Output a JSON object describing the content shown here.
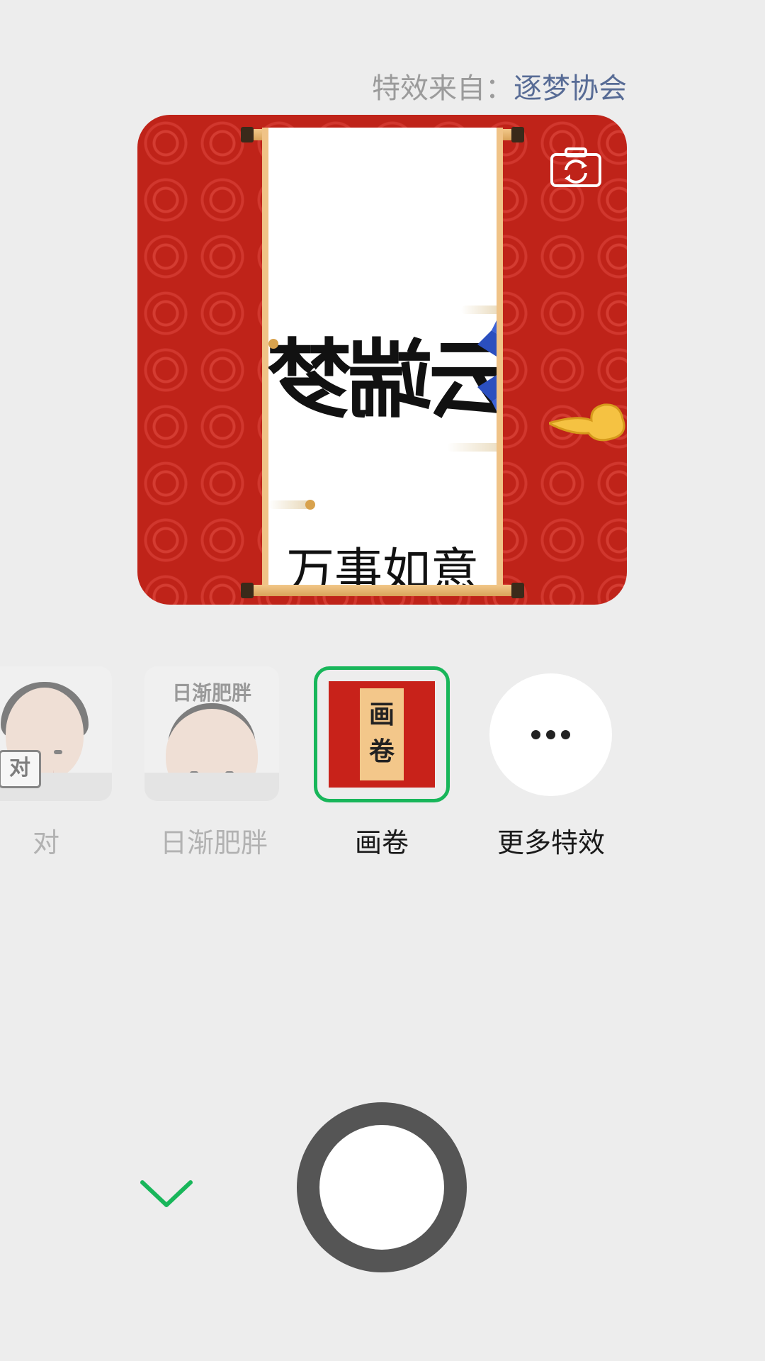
{
  "header": {
    "credit_prefix": "特效来自：",
    "credit_author": "逐梦协会"
  },
  "preview": {
    "logo_text": "云端梦",
    "caption": "万事如意",
    "camera_switch_icon": "camera-switch-icon"
  },
  "effects": [
    {
      "label": "对",
      "state": "partial"
    },
    {
      "label": "日渐肥胖",
      "headline": "日渐肥胖"
    },
    {
      "label": "画卷",
      "selected": true,
      "thumb_text": "画卷"
    },
    {
      "label": "更多特效",
      "icon": "more-dots-icon"
    }
  ],
  "controls": {
    "collapse_icon": "chevron-down-icon",
    "shutter_icon": "shutter-button",
    "accent": "#18b65a"
  },
  "colors": {
    "background": "#ededed",
    "link": "#576b95",
    "muted": "#9b9b9b",
    "selected_border": "#18b65a",
    "preview_red": "#bf2319"
  }
}
